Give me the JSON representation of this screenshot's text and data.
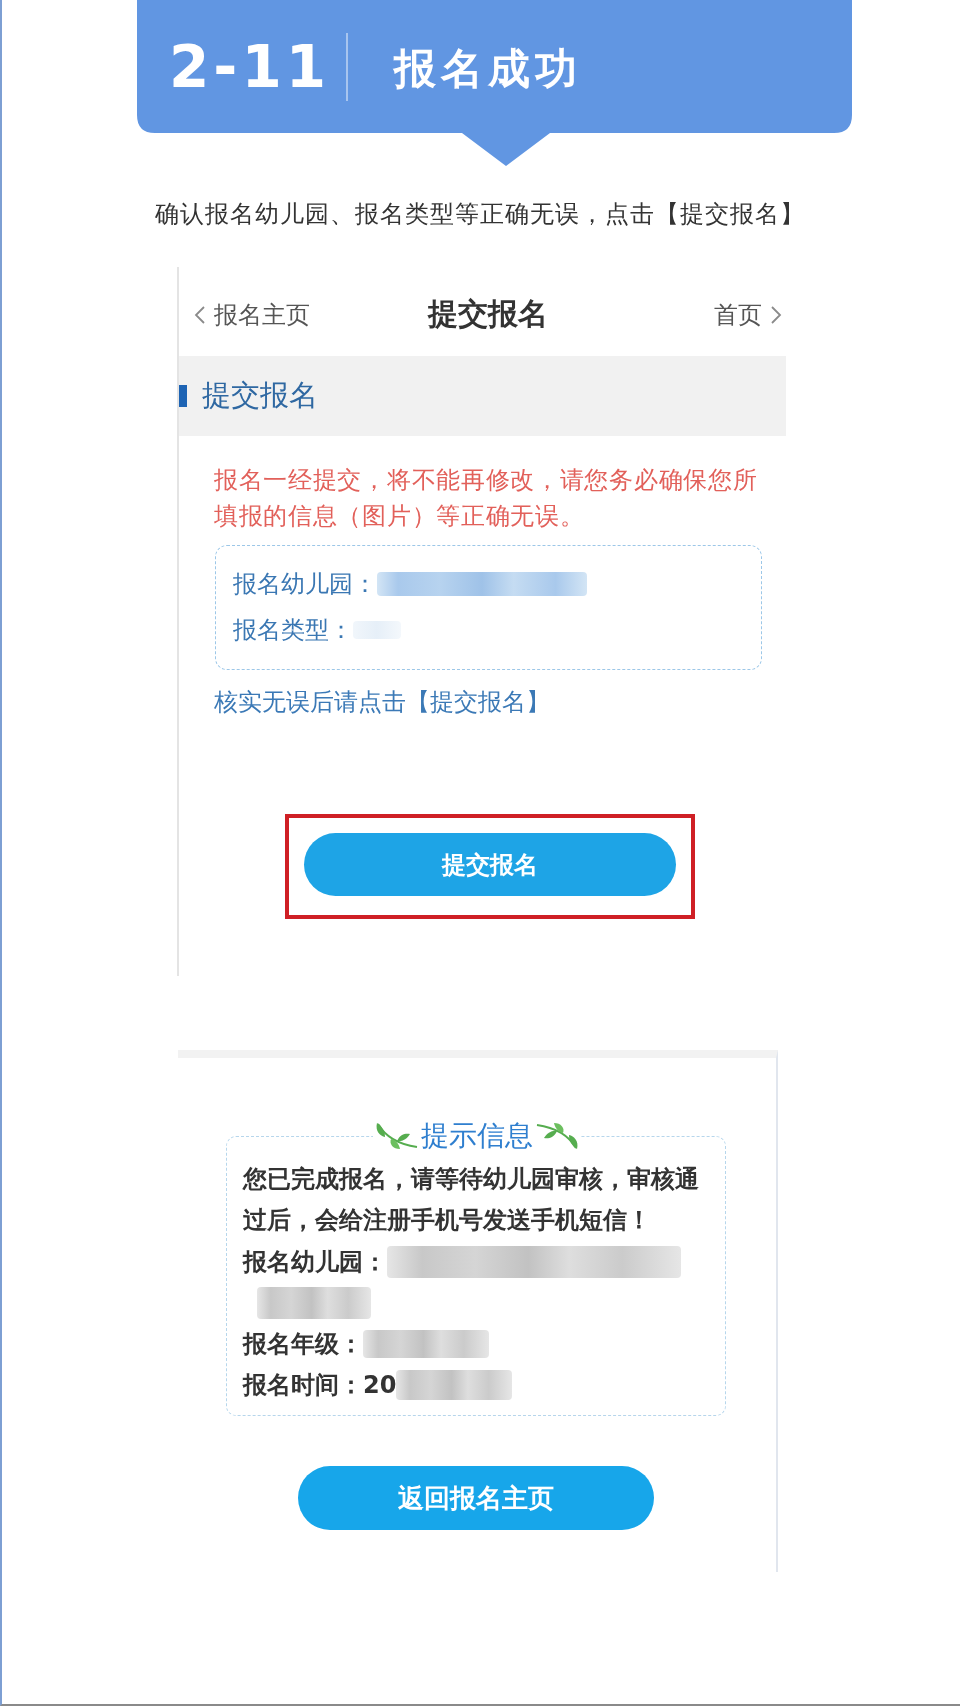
{
  "banner": {
    "number": "2-11",
    "title": "报名成功"
  },
  "instruction": "确认报名幼儿园、报名类型等正确无误，点击【提交报名】",
  "submit_screen": {
    "nav": {
      "back": "报名主页",
      "title": "提交报名",
      "forward": "首页"
    },
    "section_title": "提交报名",
    "warning": "报名一经提交，将不能再修改，请您务必确保您所填报的信息（图片）等正确无误。",
    "fields": [
      {
        "label": "报名幼儿园：",
        "blurred": true
      },
      {
        "label": "报名类型：",
        "blurred": true
      }
    ],
    "confirm_hint": "核实无误后请点击【提交报名】",
    "submit_button": {
      "label": "提交报名",
      "highlighted": true
    }
  },
  "success_screen": {
    "heading": "提示信息",
    "lines": [
      {
        "kind": "message",
        "text": "您已完成报名，请等待幼儿园审核，审核通过后，会给注册手机号发送手机短信！"
      },
      {
        "kind": "field",
        "label": "报名幼儿园：",
        "blurred": true
      },
      {
        "kind": "blur"
      },
      {
        "kind": "field",
        "label": "报名年级：",
        "blurred": true
      },
      {
        "kind": "field",
        "label": "报名时间：",
        "value": "20",
        "blurred": true
      }
    ],
    "button": "返回报名主页"
  }
}
